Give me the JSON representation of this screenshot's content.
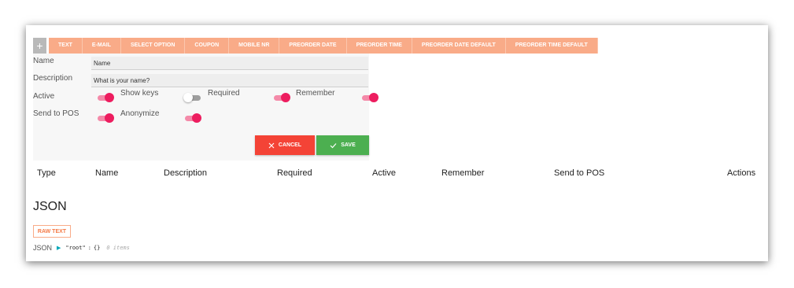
{
  "field_tabs": {
    "add_label": "+",
    "items": [
      "TEXT",
      "E-MAIL",
      "SELECT OPTION",
      "COUPON",
      "MOBILE NR",
      "PREORDER DATE",
      "PREORDER TIME",
      "PREORDER DATE DEFAULT",
      "PREORDER TIME DEFAULT"
    ]
  },
  "form": {
    "name_label": "Name",
    "name_value": "Name",
    "description_label": "Description",
    "description_value": "What is your name?",
    "active_label": "Active",
    "active_on": true,
    "show_keys_label": "Show keys",
    "show_keys_on": false,
    "required_label": "Required",
    "required_on": true,
    "remember_label": "Remember",
    "remember_on": true,
    "send_to_pos_label": "Send to POS",
    "send_to_pos_on": true,
    "anonymize_label": "Anonymize",
    "anonymize_on": true,
    "cancel_label": "CANCEL",
    "save_label": "SAVE"
  },
  "table": {
    "headers": [
      "Type",
      "Name",
      "Description",
      "Required",
      "Active",
      "Remember",
      "Send to POS",
      "Actions"
    ]
  },
  "json_section": {
    "title": "JSON",
    "raw_button_label": "RAW TEXT",
    "viewer_label": "JSON",
    "root_key": "\"root\"",
    "separator": ":",
    "braces": "{}",
    "item_count": "0 items"
  },
  "colors": {
    "tab_bg": "#f9ab88",
    "toggle_on": "#ed1d5f",
    "cancel": "#f44336",
    "save": "#4caf50"
  },
  "icons": {
    "cancel": "close-icon",
    "save": "check-icon",
    "expand": "caret-right-icon"
  }
}
